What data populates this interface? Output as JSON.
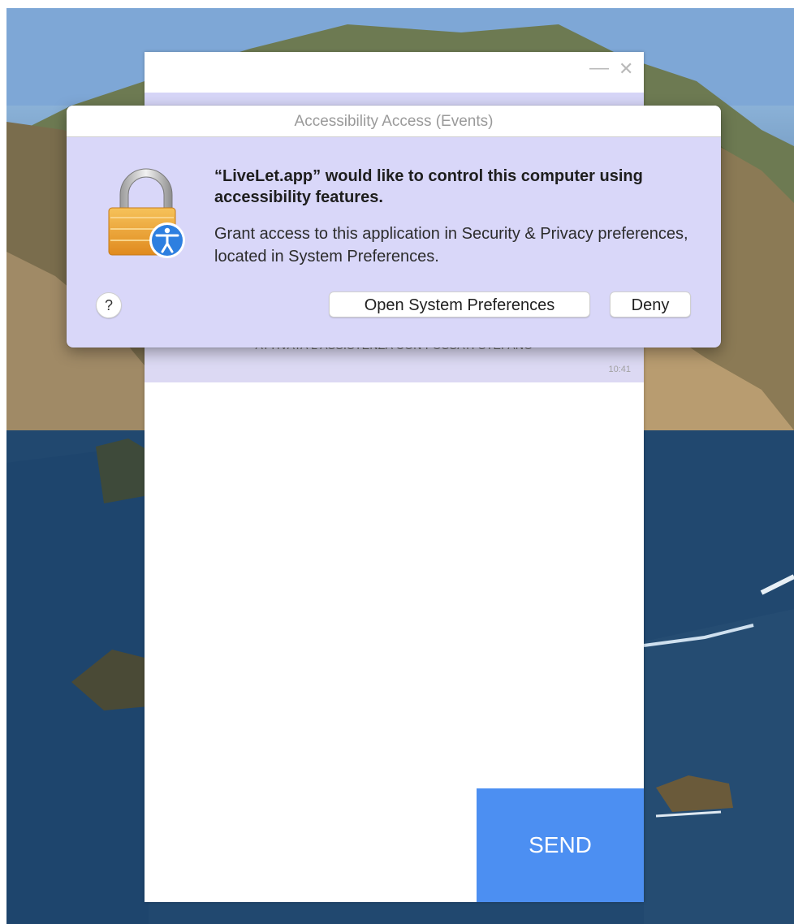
{
  "alert": {
    "title": "Accessibility Access (Events)",
    "heading": "“LiveLet.app” would like to control this computer using accessibility features.",
    "body": "Grant access to this application in Security & Privacy preferences, located in System Preferences.",
    "help_label": "?",
    "primary_button": "Open System Preferences",
    "secondary_button": "Deny"
  },
  "app": {
    "minimize_glyph": "—",
    "close_glyph": "✕",
    "system_message": "ATTIVATA L'ASSISTENZA CON FOSSATI STEFANO",
    "system_message_time": "10:41",
    "send_label": "SEND"
  },
  "colors": {
    "send_button": "#4c8ff2",
    "chat_band": "#d6d5f7",
    "alert_background": "#d9d7f9"
  },
  "icons": {
    "lock": "lock-icon",
    "accessibility_badge": "accessibility-icon"
  }
}
